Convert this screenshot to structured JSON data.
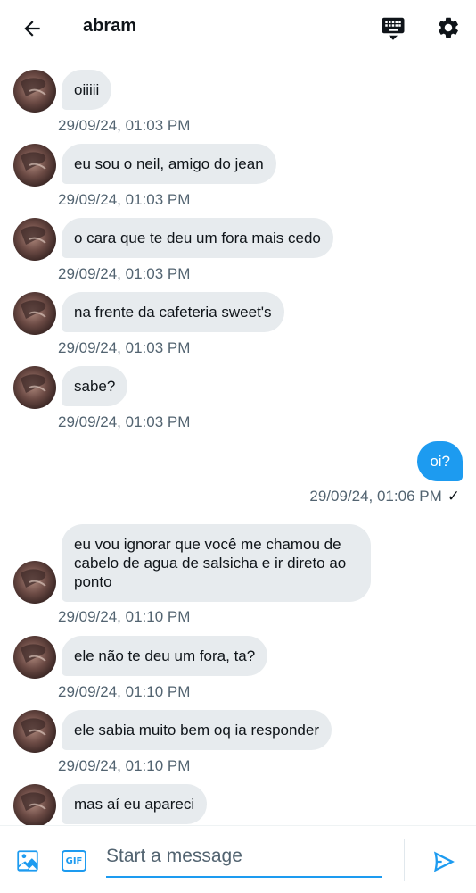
{
  "header": {
    "title": "abram",
    "back_icon": "arrow-left-icon",
    "keyboard_icon": "keyboard-icon",
    "settings_icon": "gear-icon"
  },
  "messages": [
    {
      "text": "oiiiii",
      "time": "29/09/24, 01:03 PM"
    },
    {
      "text": "eu sou o neil, amigo do jean",
      "time": "29/09/24, 01:03 PM"
    },
    {
      "text": "o cara que te deu um fora mais cedo",
      "time": "29/09/24, 01:03 PM"
    },
    {
      "text": "na frente da cafeteria sweet's",
      "time": "29/09/24, 01:03 PM"
    },
    {
      "text": "sabe?",
      "time": "29/09/24, 01:03 PM"
    },
    {
      "text": "oi?",
      "time": "29/09/24, 01:06 PM",
      "status": "✓"
    },
    {
      "text": "eu vou ignorar que você me chamou de cabelo de agua de salsicha e ir direto ao ponto",
      "time": "29/09/24, 01:10 PM"
    },
    {
      "text": "ele não te deu um fora, ta?",
      "time": "29/09/24, 01:10 PM"
    },
    {
      "text": "ele sabia muito bem oq ia responder",
      "time": "29/09/24, 01:10 PM"
    },
    {
      "text": "mas aí eu apareci",
      "time": ""
    }
  ],
  "composer": {
    "placeholder": "Start a message",
    "gif_label": "GIF",
    "image_icon": "image-icon",
    "send_icon": "send-icon"
  },
  "colors": {
    "accent": "#1d9bf0",
    "bubble_in": "#e7ebee",
    "timestamp": "#536471"
  }
}
